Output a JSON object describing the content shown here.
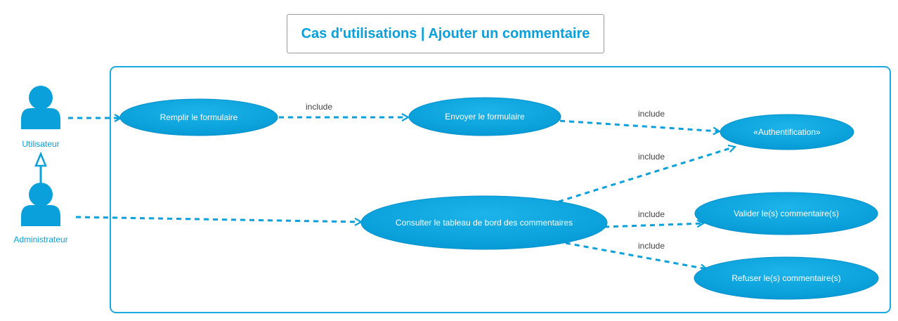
{
  "title": "Cas d'utilisations | Ajouter un commentaire",
  "actors": {
    "user": "Utilisateur",
    "admin": "Administrateur"
  },
  "use_cases": {
    "remplir": "Remplir le formulaire",
    "envoyer": "Envoyer le formulaire",
    "auth": "«Authentification»",
    "consulter": "Consulter le tableau de bord des commentaires",
    "valider": "Valider le(s) commentaire(s)",
    "refuser": "Refuser le(s) commentaire(s)"
  },
  "relations": {
    "remplir_envoyer": "include",
    "envoyer_auth": "include",
    "consulter_auth": "include",
    "consulter_valider": "include",
    "consulter_refuser": "include"
  },
  "colors": {
    "accent": "#0aa0dc",
    "usecase_fill": "#0aa6e0",
    "title_border": "#9a9a9a"
  }
}
